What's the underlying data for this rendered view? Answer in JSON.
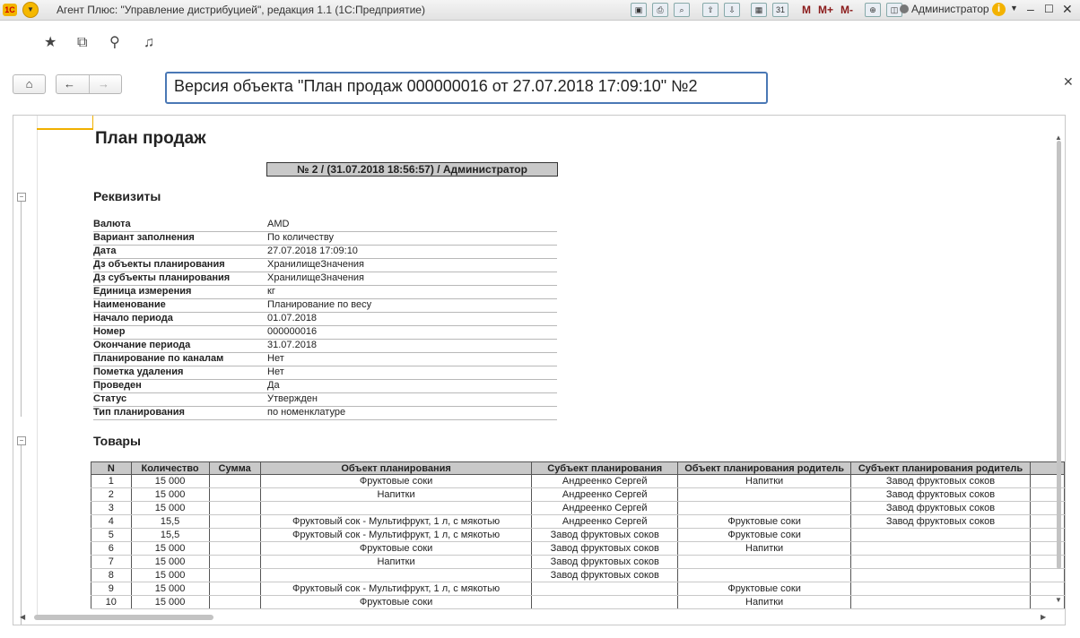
{
  "window": {
    "app_title": "Агент Плюс: \"Управление дистрибуцией\", редакция 1.1  (1С:Предприятие)",
    "user": "Администратор",
    "toolbar_m": [
      "M",
      "M+",
      "M-"
    ]
  },
  "doc": {
    "title": "Версия объекта \"План продаж 000000016 от 27.07.2018 17:09:10\" №2"
  },
  "report": {
    "title": "План продаж",
    "version_line": "№ 2 / (31.07.2018 18:56:57) / Администратор",
    "section_attrs": "Реквизиты",
    "section_goods": "Товары",
    "attributes": [
      {
        "k": "Валюта",
        "v": "AMD"
      },
      {
        "k": "Вариант заполнения",
        "v": "По количеству"
      },
      {
        "k": "Дата",
        "v": "27.07.2018 17:09:10"
      },
      {
        "k": "Дз объекты планирования",
        "v": "ХранилищеЗначения"
      },
      {
        "k": "Дз субъекты планирования",
        "v": "ХранилищеЗначения"
      },
      {
        "k": "Единица измерения",
        "v": "кг"
      },
      {
        "k": "Наименование",
        "v": "Планирование по весу"
      },
      {
        "k": "Начало периода",
        "v": "01.07.2018"
      },
      {
        "k": "Номер",
        "v": "000000016"
      },
      {
        "k": "Окончание периода",
        "v": "31.07.2018"
      },
      {
        "k": "Планирование по каналам",
        "v": "Нет"
      },
      {
        "k": "Пометка удаления",
        "v": "Нет"
      },
      {
        "k": "Проведен",
        "v": "Да"
      },
      {
        "k": "Статус",
        "v": "Утвержден"
      },
      {
        "k": "Тип планирования",
        "v": "по номенклатуре"
      }
    ],
    "goods_columns": [
      "N",
      "Количество",
      "Сумма",
      "Объект планирования",
      "Субъект планирования",
      "Объект планирования родитель",
      "Субъект планирования родитель"
    ],
    "goods_rows": [
      [
        "1",
        "15 000",
        "",
        "Фруктовые соки",
        "Андреенко Сергей",
        "Напитки",
        "Завод фруктовых соков"
      ],
      [
        "2",
        "15 000",
        "",
        "Напитки",
        "Андреенко Сергей",
        "",
        "Завод фруктовых соков"
      ],
      [
        "3",
        "15 000",
        "",
        "",
        "Андреенко Сергей",
        "",
        "Завод фруктовых соков"
      ],
      [
        "4",
        "15,5",
        "",
        "Фруктовый сок - Мультифрукт, 1 л, с мякотью",
        "Андреенко Сергей",
        "Фруктовые соки",
        "Завод фруктовых соков"
      ],
      [
        "5",
        "15,5",
        "",
        "Фруктовый сок - Мультифрукт, 1 л, с мякотью",
        "Завод фруктовых соков",
        "Фруктовые соки",
        ""
      ],
      [
        "6",
        "15 000",
        "",
        "Фруктовые соки",
        "Завод фруктовых соков",
        "Напитки",
        ""
      ],
      [
        "7",
        "15 000",
        "",
        "Напитки",
        "Завод фруктовых соков",
        "",
        ""
      ],
      [
        "8",
        "15 000",
        "",
        "",
        "Завод фруктовых соков",
        "",
        ""
      ],
      [
        "9",
        "15 000",
        "",
        "Фруктовый сок - Мультифрукт, 1 л, с мякотью",
        "",
        "Фруктовые соки",
        ""
      ],
      [
        "10",
        "15 000",
        "",
        "Фруктовые соки",
        "",
        "Напитки",
        ""
      ]
    ]
  }
}
